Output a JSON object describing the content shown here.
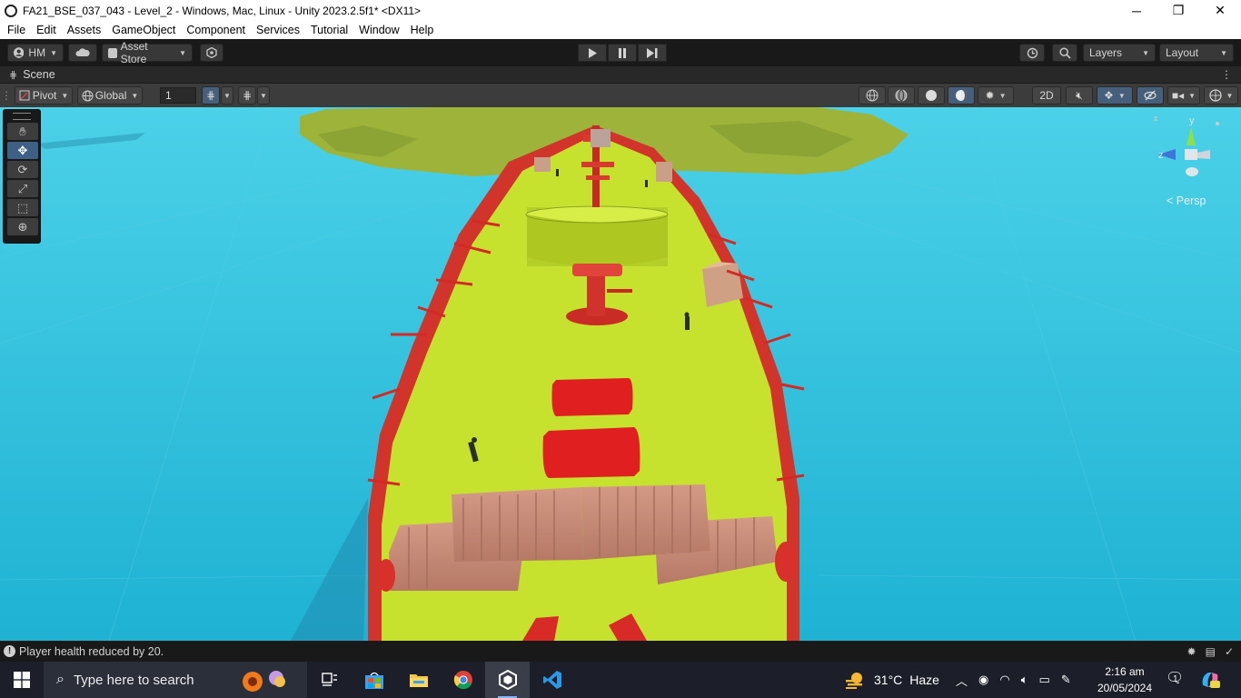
{
  "window": {
    "title": "FA21_BSE_037_043 - Level_2 - Windows, Mac, Linux - Unity 2023.2.5f1* <DX11>",
    "controls": [
      "─",
      "❐",
      "✕"
    ]
  },
  "menu": [
    "File",
    "Edit",
    "Assets",
    "GameObject",
    "Component",
    "Services",
    "Tutorial",
    "Window",
    "Help"
  ],
  "toolbar": {
    "account_label": "HM",
    "asset_store_label": "Asset Store",
    "layers_label": "Layers",
    "layout_label": "Layout",
    "play_icon": "play-icon",
    "pause_icon": "pause-icon",
    "step_icon": "step-icon"
  },
  "scene_tab": {
    "label": "Scene"
  },
  "scene_toolbar": {
    "pivot_label": "Pivot",
    "global_label": "Global",
    "grid_snap_value": "1",
    "mode_2d_label": "2D"
  },
  "tools": [
    "hand-tool-icon",
    "move-tool-icon",
    "rotate-tool-icon",
    "scale-tool-icon",
    "rect-tool-icon",
    "transform-tool-icon"
  ],
  "gizmo": {
    "y_label": "y",
    "z_label": "z",
    "persp_label": "Persp"
  },
  "status": {
    "message": "Player health reduced by 20."
  },
  "taskbar": {
    "search_placeholder": "Type here to search",
    "weather_temp": "31°C",
    "weather_desc": "Haze",
    "time": "2:16 am",
    "date": "20/05/2024",
    "notification_count": "1"
  },
  "colors": {
    "sea": "#21b7d6",
    "deck": "#c6e22e",
    "ship_red": "#d42a2a",
    "container": "#c88a74"
  }
}
